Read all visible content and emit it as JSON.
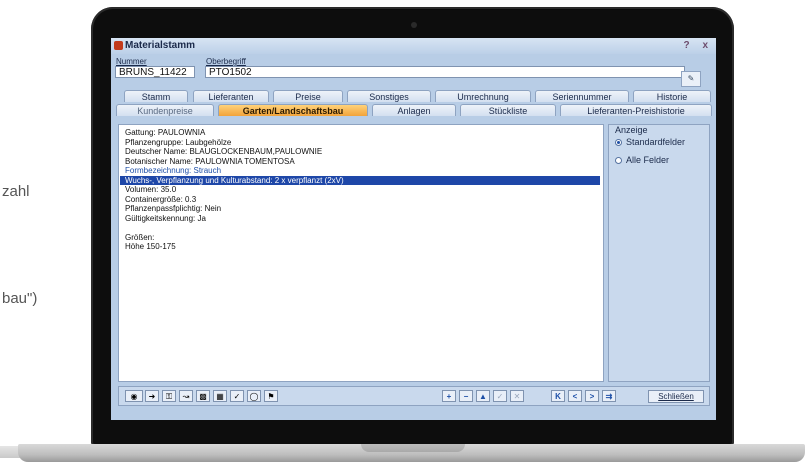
{
  "background": {
    "left_text_1": "zahl",
    "left_text_2": "bau\")"
  },
  "window": {
    "title": "Materialstamm",
    "controls": [
      "?",
      "x"
    ]
  },
  "header": {
    "nummer_label": "Nummer",
    "nummer_value": "BRUNS_11422",
    "oberbegriff_label": "Oberbegriff",
    "oberbegriff_value": "PTO1502",
    "help_icon": "help-icon"
  },
  "tabs_row1": [
    {
      "label": "Stamm"
    },
    {
      "label": "Lieferanten"
    },
    {
      "label": "Preise"
    },
    {
      "label": "Sonstiges"
    },
    {
      "label": "Umrechnung"
    },
    {
      "label": "Seriennummer"
    },
    {
      "label": "Historie"
    }
  ],
  "tabs_row2": [
    {
      "label": "Kundenpreise"
    },
    {
      "label": "Garten/Landschaftsbau",
      "active": true
    },
    {
      "label": "Anlagen"
    },
    {
      "label": "Stückliste"
    },
    {
      "label": "Lieferanten-Preishistorie"
    }
  ],
  "content_lines": [
    "Gattung: PAULOWNIA",
    "Pflanzengruppe: Laubgehölze",
    "Deutscher Name: BLAUGLOCKENBAUM,PAULOWNIE",
    "Botanischer Name: PAULOWNIA TOMENTOSA",
    "Formbezeichnung: Strauch",
    "Wuchs-, Verpflanzung und Kulturabstand: 2 x verpflanzt (2xV)",
    "Volumen: 35.0",
    "Containergröße: 0.3",
    "Pflanzenpassfplichtig: Nein",
    "Gültigkeitskennung: Ja",
    "",
    "Größen:",
    "Höhe 150-175"
  ],
  "sidebar": {
    "header": "Anzeige",
    "options": [
      {
        "label": "Standardfelder",
        "selected": true
      },
      {
        "label": "Alle Felder",
        "selected": false
      }
    ]
  },
  "toolbar": {
    "left_icons": [
      "glasses-icon",
      "export-icon",
      "key-icon",
      "chart-icon",
      "image-icon",
      "calendar-icon",
      "tag-icon",
      "circle-icon",
      "pin-icon"
    ],
    "edit_icons": [
      "add-icon",
      "remove-icon",
      "up-icon",
      "check-icon",
      "cancel-icon"
    ],
    "nav_icons": [
      "first-icon",
      "prev-icon",
      "next-icon",
      "last-icon"
    ],
    "close_label": "Schließen"
  },
  "colors": {
    "active_tab": "#f2a33a",
    "selection": "#1e47a8",
    "window_bg": "#b8cde6"
  }
}
